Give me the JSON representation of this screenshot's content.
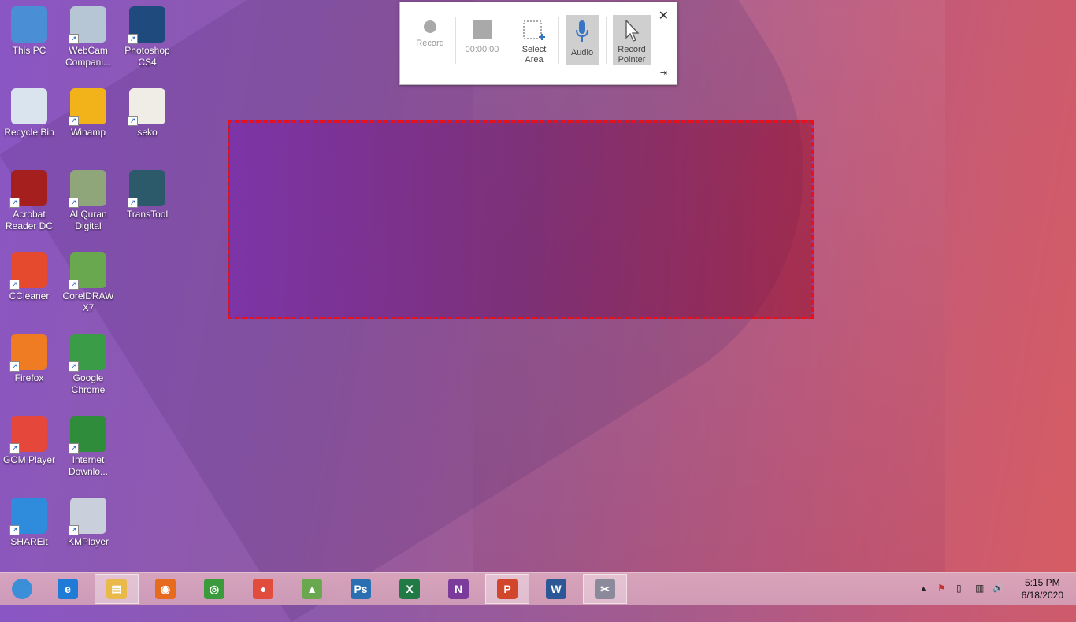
{
  "desktop": {
    "icons": [
      {
        "label": "This PC",
        "icon": "computer-icon"
      },
      {
        "label": "WebCam Compani...",
        "icon": "webcam-icon"
      },
      {
        "label": "Photoshop CS4",
        "icon": "photoshop-icon"
      },
      {
        "label": "Recycle Bin",
        "icon": "recycle-bin-icon"
      },
      {
        "label": "Winamp",
        "icon": "winamp-icon"
      },
      {
        "label": "seko",
        "icon": "powerpoint-file-icon"
      },
      {
        "label": "Acrobat Reader DC",
        "icon": "acrobat-icon"
      },
      {
        "label": "Al Quran Digital",
        "icon": "quran-icon"
      },
      {
        "label": "TransTool",
        "icon": "transtool-icon"
      },
      {
        "label": "CCleaner",
        "icon": "ccleaner-icon"
      },
      {
        "label": "CorelDRAW X7",
        "icon": "coreldraw-icon"
      },
      {
        "label": "Firefox",
        "icon": "firefox-icon"
      },
      {
        "label": "Google Chrome",
        "icon": "chrome-icon"
      },
      {
        "label": "GOM Player",
        "icon": "gom-player-icon"
      },
      {
        "label": "Internet Downlo...",
        "icon": "internet-download-manager-icon"
      },
      {
        "label": "SHAREit",
        "icon": "shareit-icon"
      },
      {
        "label": "KMPlayer",
        "icon": "kmplayer-icon"
      }
    ],
    "shortcut_arrow": "↗"
  },
  "recorder": {
    "record_label": "Record",
    "timer": "00:00:00",
    "select_area_label": "Select Area",
    "audio_label": "Audio",
    "record_pointer_label": "Record Pointer",
    "close_glyph": "✕",
    "pin_glyph": "⇥"
  },
  "taskbar": {
    "apps": [
      {
        "name": "start-button",
        "glyph": "",
        "color": "#3a8fd8",
        "active": false
      },
      {
        "name": "internet-explorer",
        "glyph": "e",
        "color": "#1f7bd6",
        "active": false
      },
      {
        "name": "file-explorer",
        "glyph": "▤",
        "color": "#e9b949",
        "active": true
      },
      {
        "name": "firefox",
        "glyph": "◉",
        "color": "#e66b1f",
        "active": false
      },
      {
        "name": "chrome",
        "glyph": "◎",
        "color": "#3b9a3b",
        "active": false
      },
      {
        "name": "gom-player",
        "glyph": "●",
        "color": "#e24c3c",
        "active": false
      },
      {
        "name": "coreldraw",
        "glyph": "▲",
        "color": "#6aa84f",
        "active": false
      },
      {
        "name": "photoshop",
        "glyph": "Ps",
        "color": "#2a6fb1",
        "active": false
      },
      {
        "name": "excel",
        "glyph": "X",
        "color": "#1f7a45",
        "active": false
      },
      {
        "name": "onenote",
        "glyph": "N",
        "color": "#7a3b9a",
        "active": false
      },
      {
        "name": "powerpoint",
        "glyph": "P",
        "color": "#d2472c",
        "active": true
      },
      {
        "name": "word",
        "glyph": "W",
        "color": "#2b5797",
        "active": false
      },
      {
        "name": "snipping-tool",
        "glyph": "✂",
        "color": "#8a8a9a",
        "active": true
      }
    ],
    "tray": {
      "chevron": "▲",
      "flag": "⚑",
      "power": "▯",
      "network": "▥",
      "volume": "🔊"
    },
    "time": "5:15 PM",
    "date": "6/18/2020"
  }
}
